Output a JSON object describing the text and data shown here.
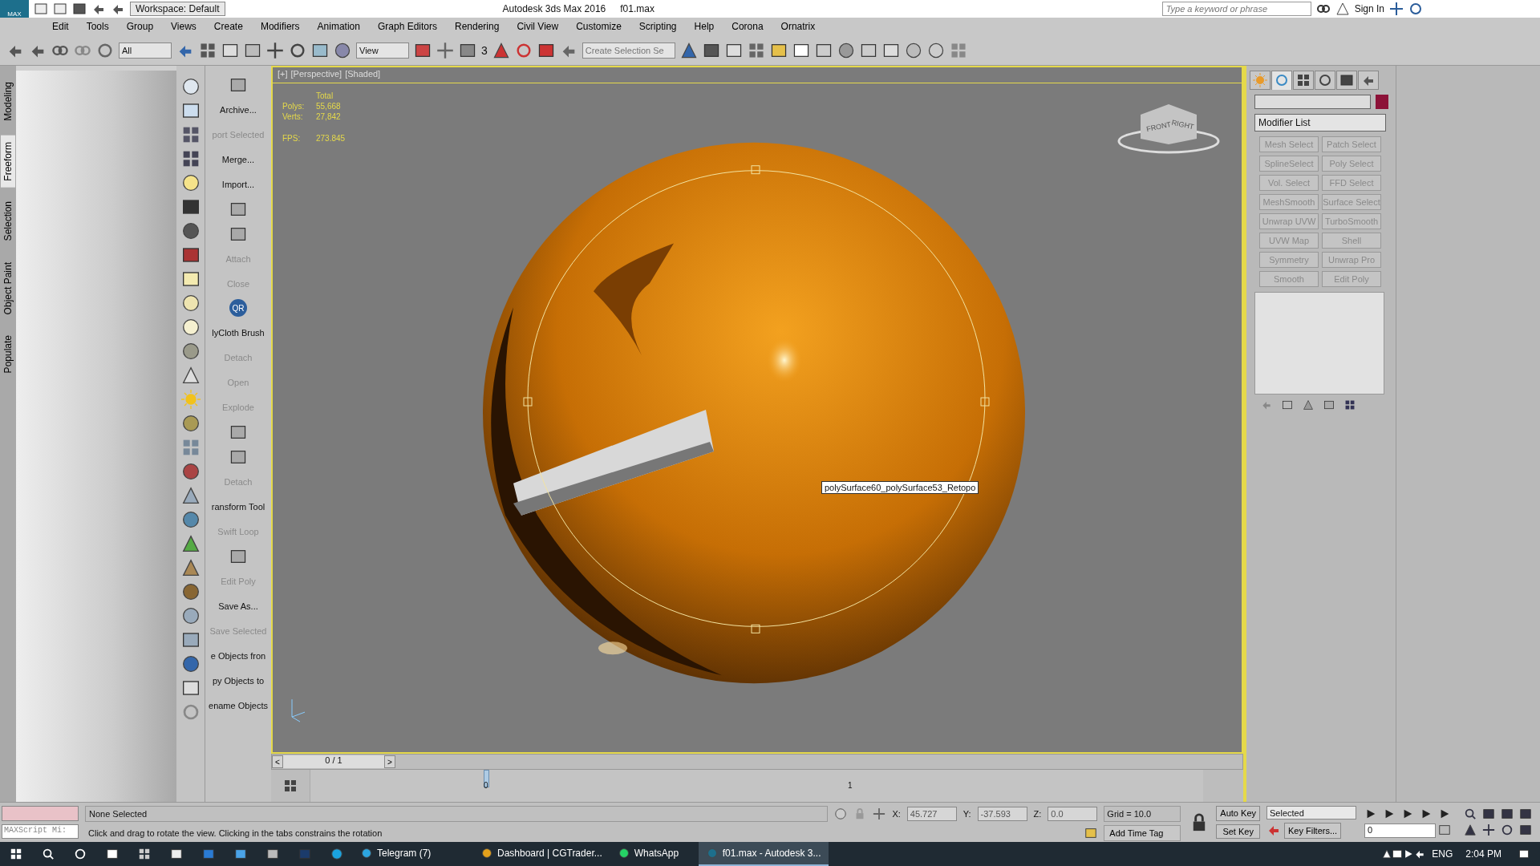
{
  "title_bar": {
    "logo": "MAX",
    "workspace": "Workspace: Default",
    "app_title": "Autodesk 3ds Max 2016",
    "file": "f01.max",
    "search": {
      "placeholder": "Type a keyword or phrase"
    },
    "sign_in": "Sign In"
  },
  "menu": [
    "Edit",
    "Tools",
    "Group",
    "Views",
    "Create",
    "Modifiers",
    "Animation",
    "Graph Editors",
    "Rendering",
    "Civil View",
    "Customize",
    "Scripting",
    "Help",
    "Corona",
    "Ornatrix"
  ],
  "toolbar": {
    "filter": "All",
    "coord_system": "View",
    "snap": "3",
    "selection_set": {
      "placeholder": "Create Selection Se"
    }
  },
  "ribbon_tabs": [
    {
      "label": "Modeling",
      "selected": false
    },
    {
      "label": "Freeform",
      "selected": true
    },
    {
      "label": "Selection",
      "selected": false
    },
    {
      "label": "Object Paint",
      "selected": false
    },
    {
      "label": "Populate",
      "selected": false
    }
  ],
  "script_buttons": [
    {
      "kind": "icon"
    },
    {
      "kind": "text",
      "label": "Archive...",
      "disabled": false
    },
    {
      "kind": "text",
      "label": "port Selected",
      "disabled": true
    },
    {
      "kind": "text",
      "label": "Merge...",
      "disabled": false
    },
    {
      "kind": "text",
      "label": "Import...",
      "disabled": false
    },
    {
      "kind": "icon"
    },
    {
      "kind": "icon"
    },
    {
      "kind": "text",
      "label": "Attach",
      "disabled": true
    },
    {
      "kind": "text",
      "label": "Close",
      "disabled": true
    },
    {
      "kind": "badge",
      "label": "QR"
    },
    {
      "kind": "text",
      "label": "lyCloth Brush",
      "disabled": false
    },
    {
      "kind": "text",
      "label": "Detach",
      "disabled": true
    },
    {
      "kind": "text",
      "label": "Open",
      "disabled": true
    },
    {
      "kind": "text",
      "label": "Explode",
      "disabled": true
    },
    {
      "kind": "icon"
    },
    {
      "kind": "icon"
    },
    {
      "kind": "text",
      "label": "Detach",
      "disabled": true
    },
    {
      "kind": "text",
      "label": "ransform Tool",
      "disabled": false
    },
    {
      "kind": "text",
      "label": "Swift Loop",
      "disabled": true
    },
    {
      "kind": "icon"
    },
    {
      "kind": "text",
      "label": "Edit Poly",
      "disabled": true
    },
    {
      "kind": "text",
      "label": "Save As...",
      "disabled": false
    },
    {
      "kind": "text",
      "label": "Save Selected",
      "disabled": true
    },
    {
      "kind": "text",
      "label": "e Objects fron",
      "disabled": false
    },
    {
      "kind": "text",
      "label": "py Objects to",
      "disabled": false
    },
    {
      "kind": "text",
      "label": "ename Objects",
      "disabled": false
    }
  ],
  "viewport": {
    "labels": [
      "[+]",
      "[Perspective]",
      "[Shaded]"
    ],
    "stats": {
      "header": "Total",
      "rows": [
        {
          "label": "Polys:",
          "value": "55,668"
        },
        {
          "label": "Verts:",
          "value": "27,842"
        },
        {
          "label": "FPS:",
          "value": "273.845"
        }
      ]
    },
    "viewcube": {
      "front": "FRONT",
      "right": "RIGHT"
    },
    "tooltip": "polySurface60_polySurface53_Retopo"
  },
  "command_panel": {
    "tabs": [
      {
        "selected": false
      },
      {
        "selected": true
      },
      {
        "selected": false
      },
      {
        "selected": false
      },
      {
        "selected": false
      },
      {
        "selected": false
      }
    ],
    "modifier_list": "Modifier List",
    "modifiers": [
      {
        "label": "Mesh Select",
        "disabled": true
      },
      {
        "label": "Patch Select",
        "disabled": true
      },
      {
        "label": "SplineSelect",
        "disabled": true
      },
      {
        "label": "Poly Select",
        "disabled": true
      },
      {
        "label": "Vol. Select",
        "disabled": true
      },
      {
        "label": "FFD Select",
        "disabled": true
      },
      {
        "label": "MeshSmooth",
        "disabled": true
      },
      {
        "label": "Surface Select",
        "disabled": true
      },
      {
        "label": "Unwrap UVW",
        "disabled": true
      },
      {
        "label": "TurboSmooth",
        "disabled": true
      },
      {
        "label": "UVW Map",
        "disabled": true
      },
      {
        "label": "Shell",
        "disabled": true
      },
      {
        "label": "Symmetry",
        "disabled": true
      },
      {
        "label": "Unwrap Pro",
        "disabled": true
      },
      {
        "label": "Smooth",
        "disabled": true
      },
      {
        "label": "Edit Poly",
        "disabled": true
      }
    ]
  },
  "timeline": {
    "prev": "<",
    "frame": "0 / 1",
    "next": ">",
    "ticks": [
      "0",
      "1"
    ]
  },
  "status": {
    "maxscript": "MAXScript Mi:",
    "selection": "None Selected",
    "prompt": "Click and drag to rotate the view.  Clicking in the tabs constrains the rotation",
    "coords": [
      {
        "label": "X:",
        "value": "45.727"
      },
      {
        "label": "Y:",
        "value": "-37.593"
      },
      {
        "label": "Z:",
        "value": "0.0"
      }
    ],
    "grid": "Grid = 10.0",
    "add_time_tag": "Add Time Tag",
    "auto_key": "Auto Key",
    "set_key": "Set Key",
    "key_mode": "Selected",
    "key_filters": "Key Filters...",
    "frame": "0"
  },
  "taskbar": {
    "apps": [
      {
        "label": "Telegram (7)",
        "selected": false
      },
      {
        "label": "Dashboard | CGTrader...",
        "selected": false
      },
      {
        "label": "WhatsApp",
        "selected": false
      },
      {
        "label": "f01.max - Autodesk 3...",
        "selected": true
      }
    ],
    "language": "ENG",
    "time": "2:04 PM"
  }
}
